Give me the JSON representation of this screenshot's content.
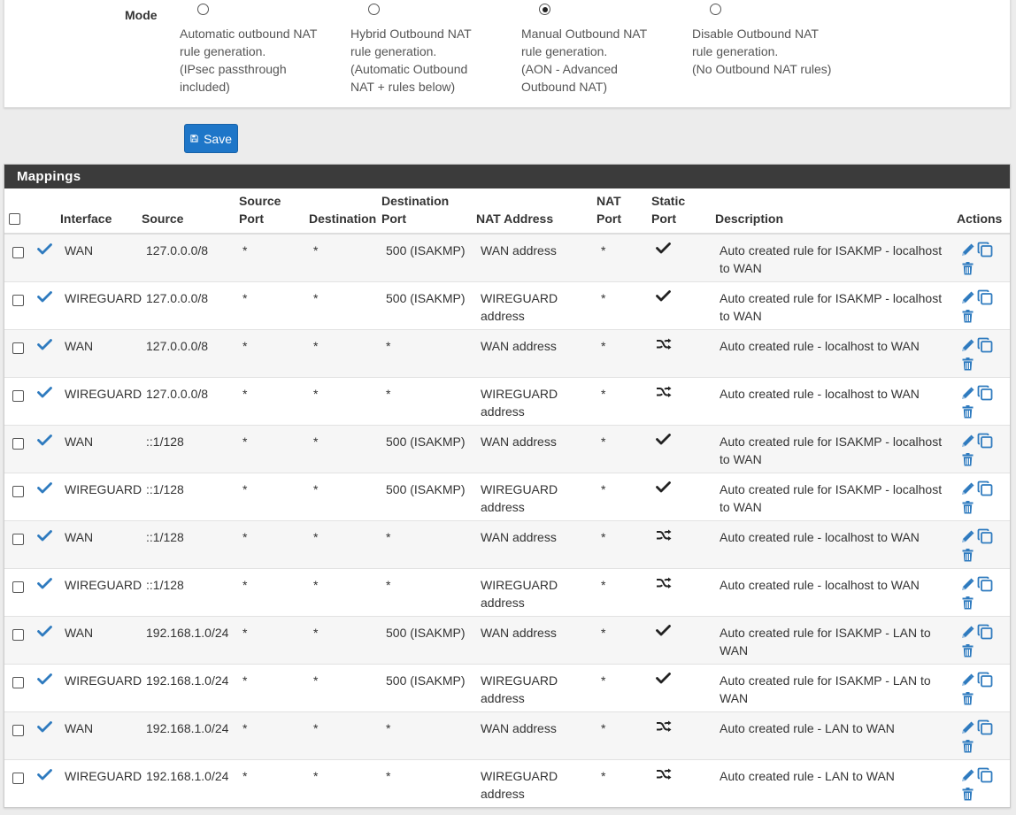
{
  "mode": {
    "label": "Mode",
    "options": [
      {
        "text": "Automatic outbound NAT\nrule generation.\n(IPsec passthrough\nincluded)",
        "checked": false
      },
      {
        "text": "Hybrid Outbound NAT\nrule generation.\n(Automatic Outbound\nNAT + rules below)",
        "checked": false
      },
      {
        "text": "Manual Outbound NAT\nrule generation.\n(AON - Advanced\nOutbound NAT)",
        "checked": true
      },
      {
        "text": "Disable Outbound NAT\nrule generation.\n(No Outbound NAT rules)",
        "checked": false
      }
    ]
  },
  "save_label": "Save",
  "mappings": {
    "title": "Mappings",
    "headers": {
      "interface": "Interface",
      "source": "Source",
      "source_port_1": "Source",
      "source_port_2": "Port",
      "destination": "Destination",
      "dest_port_1": "Destination",
      "dest_port_2": "Port",
      "nat_address": "NAT Address",
      "nat_port_1": "NAT",
      "nat_port_2": "Port",
      "static_port_1": "Static",
      "static_port_2": "Port",
      "description": "Description",
      "actions": "Actions"
    },
    "rows": [
      {
        "interface": "WAN",
        "source": "127.0.0.0/8",
        "source_port": "*",
        "destination": "*",
        "dest_port": "500 (ISAKMP)",
        "nat_address_1": "WAN address",
        "nat_address_2": "",
        "nat_port": "*",
        "static_icon": "check-icon",
        "desc_1": "Auto created rule for ISAKMP - localhost",
        "desc_2": "to WAN"
      },
      {
        "interface": "WIREGUARD",
        "source": "127.0.0.0/8",
        "source_port": "*",
        "destination": "*",
        "dest_port": "500 (ISAKMP)",
        "nat_address_1": "WIREGUARD",
        "nat_address_2": "address",
        "nat_port": "*",
        "static_icon": "check-icon",
        "desc_1": "Auto created rule for ISAKMP - localhost",
        "desc_2": "to WAN"
      },
      {
        "interface": "WAN",
        "source": "127.0.0.0/8",
        "source_port": "*",
        "destination": "*",
        "dest_port": "*",
        "nat_address_1": "WAN address",
        "nat_address_2": "",
        "nat_port": "*",
        "static_icon": "shuffle-icon",
        "desc_1": "Auto created rule - localhost to WAN",
        "desc_2": ""
      },
      {
        "interface": "WIREGUARD",
        "source": "127.0.0.0/8",
        "source_port": "*",
        "destination": "*",
        "dest_port": "*",
        "nat_address_1": "WIREGUARD",
        "nat_address_2": "address",
        "nat_port": "*",
        "static_icon": "shuffle-icon",
        "desc_1": "Auto created rule - localhost to WAN",
        "desc_2": ""
      },
      {
        "interface": "WAN",
        "source": "::1/128",
        "source_port": "*",
        "destination": "*",
        "dest_port": "500 (ISAKMP)",
        "nat_address_1": "WAN address",
        "nat_address_2": "",
        "nat_port": "*",
        "static_icon": "check-icon",
        "desc_1": "Auto created rule for ISAKMP - localhost",
        "desc_2": "to WAN"
      },
      {
        "interface": "WIREGUARD",
        "source": "::1/128",
        "source_port": "*",
        "destination": "*",
        "dest_port": "500 (ISAKMP)",
        "nat_address_1": "WIREGUARD",
        "nat_address_2": "address",
        "nat_port": "*",
        "static_icon": "check-icon",
        "desc_1": "Auto created rule for ISAKMP - localhost",
        "desc_2": "to WAN"
      },
      {
        "interface": "WAN",
        "source": "::1/128",
        "source_port": "*",
        "destination": "*",
        "dest_port": "*",
        "nat_address_1": "WAN address",
        "nat_address_2": "",
        "nat_port": "*",
        "static_icon": "shuffle-icon",
        "desc_1": "Auto created rule - localhost to WAN",
        "desc_2": ""
      },
      {
        "interface": "WIREGUARD",
        "source": "::1/128",
        "source_port": "*",
        "destination": "*",
        "dest_port": "*",
        "nat_address_1": "WIREGUARD",
        "nat_address_2": "address",
        "nat_port": "*",
        "static_icon": "shuffle-icon",
        "desc_1": "Auto created rule - localhost to WAN",
        "desc_2": ""
      },
      {
        "interface": "WAN",
        "source": "192.168.1.0/24",
        "source_port": "*",
        "destination": "*",
        "dest_port": "500 (ISAKMP)",
        "nat_address_1": "WAN address",
        "nat_address_2": "",
        "nat_port": "*",
        "static_icon": "check-icon",
        "desc_1": "Auto created rule for ISAKMP - LAN to",
        "desc_2": "WAN"
      },
      {
        "interface": "WIREGUARD",
        "source": "192.168.1.0/24",
        "source_port": "*",
        "destination": "*",
        "dest_port": "500 (ISAKMP)",
        "nat_address_1": "WIREGUARD",
        "nat_address_2": "address",
        "nat_port": "*",
        "static_icon": "check-icon",
        "desc_1": "Auto created rule for ISAKMP - LAN to",
        "desc_2": "WAN"
      },
      {
        "interface": "WAN",
        "source": "192.168.1.0/24",
        "source_port": "*",
        "destination": "*",
        "dest_port": "*",
        "nat_address_1": "WAN address",
        "nat_address_2": "",
        "nat_port": "*",
        "static_icon": "shuffle-icon",
        "desc_1": "Auto created rule - LAN to WAN",
        "desc_2": ""
      },
      {
        "interface": "WIREGUARD",
        "source": "192.168.1.0/24",
        "source_port": "*",
        "destination": "*",
        "dest_port": "*",
        "nat_address_1": "WIREGUARD",
        "nat_address_2": "address",
        "nat_port": "*",
        "static_icon": "shuffle-icon",
        "desc_1": "Auto created rule - LAN to WAN",
        "desc_2": ""
      }
    ]
  },
  "colors": {
    "accent": "#1e76c8",
    "header_bg": "#3b3b3b",
    "icon_blue": "#2f7bbf"
  }
}
